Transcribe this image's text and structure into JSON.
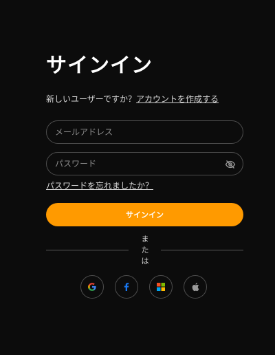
{
  "form": {
    "title": "サインイン",
    "signup_prompt": "新しいユーザーですか？",
    "signup_link": "アカウントを作成する",
    "email_placeholder": "メールアドレス",
    "password_placeholder": "パスワード",
    "forgot_link": "パスワードを忘れましたか？",
    "submit_label": "サインイン",
    "divider_text": "または"
  },
  "social": [
    {
      "icon": "google-icon"
    },
    {
      "icon": "facebook-icon"
    },
    {
      "icon": "microsoft-icon"
    },
    {
      "icon": "apple-icon"
    }
  ],
  "colors": {
    "background": "#0c0c0c",
    "accent": "#ff9a00",
    "border": "#4e4e4e",
    "text_muted": "#d6d6d6"
  }
}
